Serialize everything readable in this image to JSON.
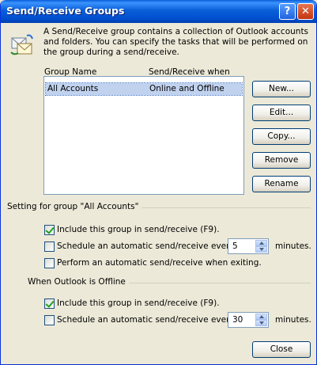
{
  "window": {
    "title": "Send/Receive Groups",
    "help_glyph": "?",
    "close_glyph": "✕"
  },
  "description": "A Send/Receive group contains a collection of Outlook accounts and folders. You can specify the tasks that will be performed on the group during a send/receive.",
  "groups_list": {
    "columns": [
      "Group Name",
      "Send/Receive when"
    ],
    "rows": [
      {
        "name": "All Accounts",
        "when": "Online and Offline",
        "selected": true
      }
    ]
  },
  "buttons": {
    "new": "New...",
    "edit": "Edit...",
    "copy": "Copy...",
    "remove": "Remove",
    "rename": "Rename",
    "close": "Close"
  },
  "settings": {
    "heading": "Setting for group \"All Accounts\"",
    "online": {
      "include": {
        "label": "Include this group in send/receive (F9).",
        "checked": true
      },
      "schedule": {
        "label": "Schedule an automatic send/receive every",
        "checked": false,
        "value": "5",
        "unit": "minutes."
      },
      "exiting": {
        "label": "Perform an automatic send/receive when exiting.",
        "checked": false
      }
    },
    "offline_heading": "When Outlook is Offline",
    "offline": {
      "include": {
        "label": "Include this group in send/receive (F9).",
        "checked": true
      },
      "schedule": {
        "label": "Schedule an automatic send/receive every",
        "checked": false,
        "value": "30",
        "unit": "minutes."
      }
    }
  }
}
